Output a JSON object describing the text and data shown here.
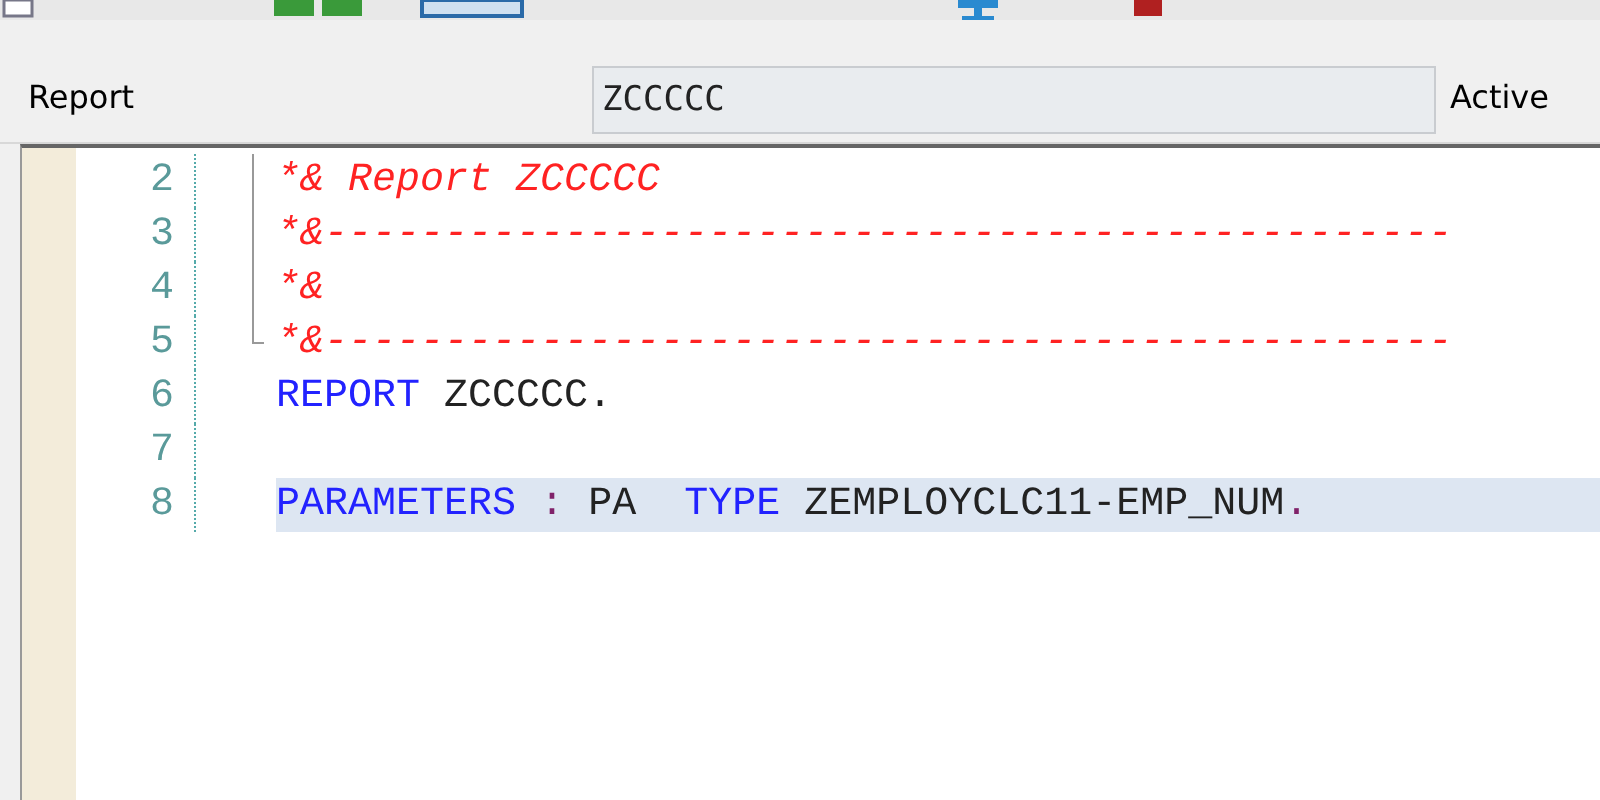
{
  "toolbar": {
    "icons": [
      {
        "kind": "page"
      },
      {
        "kind": "grid"
      },
      {
        "kind": "window"
      },
      {
        "kind": "monitor"
      },
      {
        "kind": "stop"
      }
    ]
  },
  "header": {
    "label": "Report",
    "value": "ZCCCCC",
    "status": "Active"
  },
  "editor": {
    "lines": [
      {
        "number": "2",
        "folded_region": true,
        "current": false,
        "tokens": [
          {
            "kind": "comment",
            "text": "*& Report ZCCCCC"
          }
        ]
      },
      {
        "number": "3",
        "folded_region": true,
        "current": false,
        "tokens": [
          {
            "kind": "comment",
            "text": "*&-----------------------------------------------"
          }
        ]
      },
      {
        "number": "4",
        "folded_region": true,
        "current": false,
        "tokens": [
          {
            "kind": "comment",
            "text": "*&"
          }
        ]
      },
      {
        "number": "5",
        "folded_region": true,
        "current": false,
        "tokens": [
          {
            "kind": "comment",
            "text": "*&-----------------------------------------------"
          }
        ]
      },
      {
        "number": "6",
        "folded_region": false,
        "current": false,
        "tokens": [
          {
            "kind": "keyword",
            "text": "REPORT"
          },
          {
            "kind": "name",
            "text": "ZCCCCC."
          }
        ]
      },
      {
        "number": "7",
        "folded_region": false,
        "current": false
      },
      {
        "number": "8",
        "folded_region": false,
        "current": true,
        "tokens": [
          {
            "kind": "keyword",
            "text": "PARAMETERS"
          },
          {
            "kind": "operator",
            "text": ":"
          },
          {
            "kind": "name",
            "text": "PA"
          },
          {
            "kind": "keyword",
            "text": " TYPE"
          },
          {
            "kind": "name",
            "text": "ZEMPLOYCLC11-EMP_NUM"
          },
          {
            "kind": "operator",
            "text": "."
          }
        ]
      }
    ]
  }
}
